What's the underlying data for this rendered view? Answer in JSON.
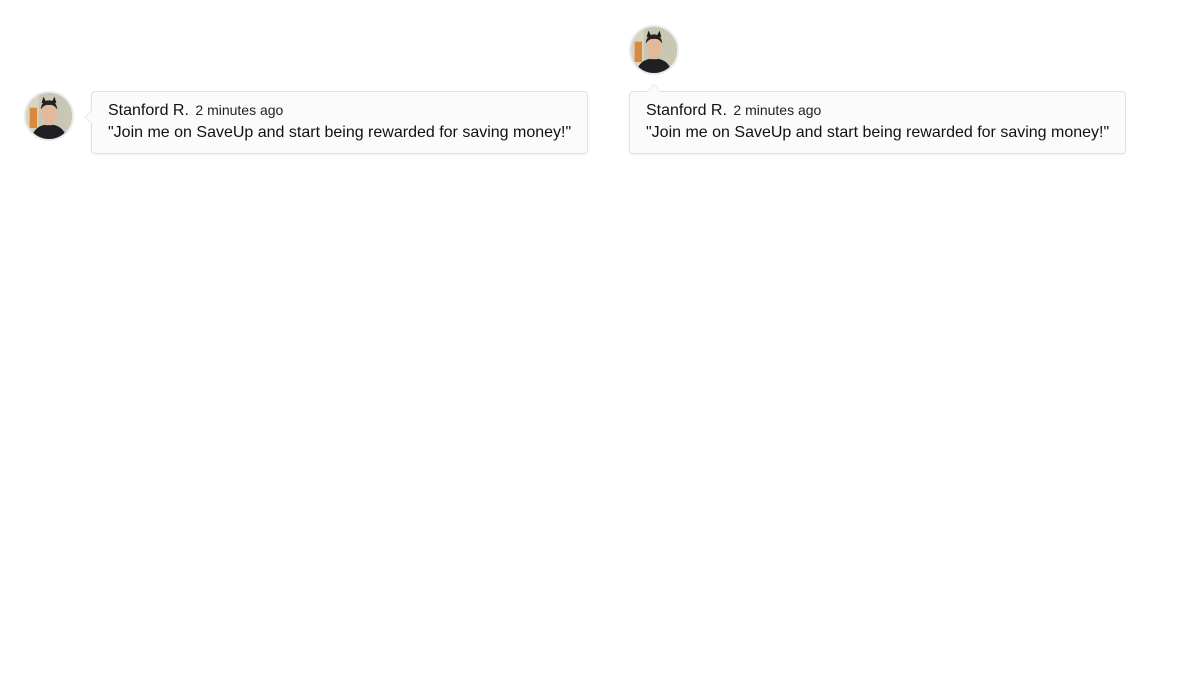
{
  "comments": [
    {
      "layout": "arrow-left",
      "author": "Stanford R.",
      "time": "2 minutes ago",
      "message": "\"Join me on SaveUp and start being rewarded for saving money!\"",
      "avatar_icon": "user-avatar-photo"
    },
    {
      "layout": "arrow-up",
      "author": "Stanford R.",
      "time": "2 minutes ago",
      "message": "\"Join me on SaveUp and start being rewarded for saving money!\"",
      "avatar_icon": "user-avatar-photo"
    }
  ],
  "colors": {
    "bubble_background": "#fbfbfb",
    "bubble_border": "#e3e3e3",
    "text": "#111111"
  }
}
